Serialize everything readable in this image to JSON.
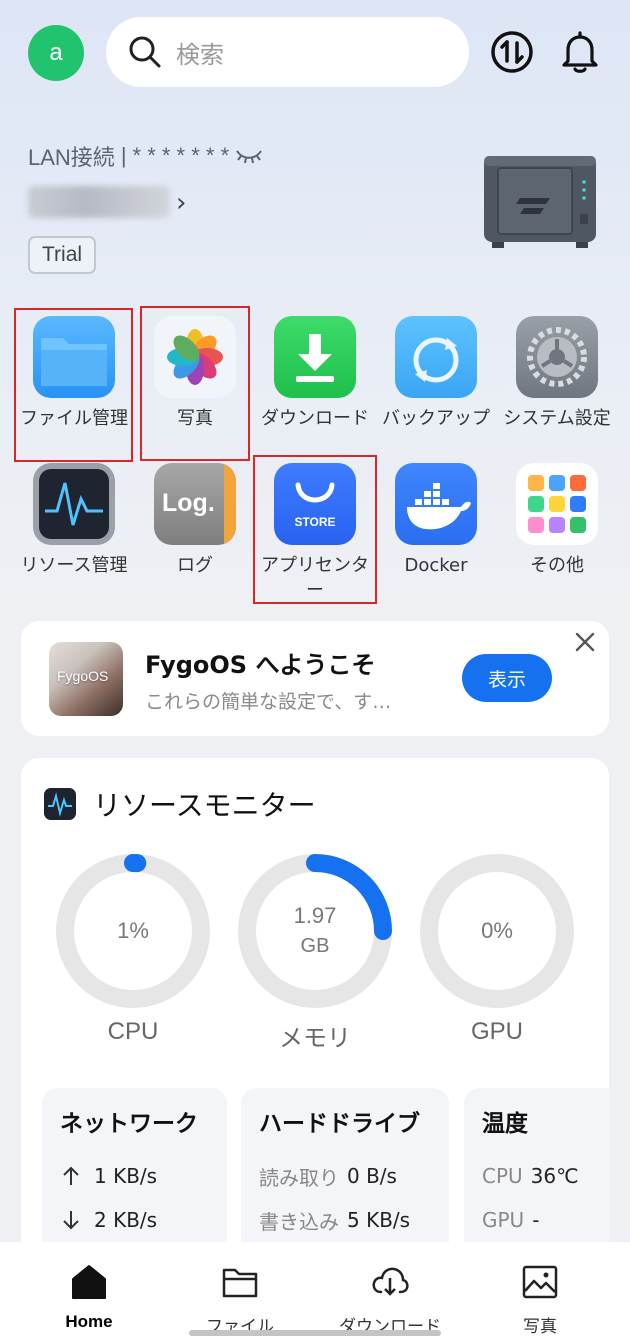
{
  "header": {
    "avatar_letter": "a",
    "search_placeholder": "検索"
  },
  "device": {
    "connection_type": "LAN接続",
    "separator": "|",
    "masked_address": "* * * * * * *",
    "trial_badge": "Trial"
  },
  "apps": [
    {
      "label": "ファイル管理",
      "icon": "folder-icon",
      "highlighted": true
    },
    {
      "label": "写真",
      "icon": "photos-icon",
      "highlighted": true
    },
    {
      "label": "ダウンロード",
      "icon": "download-icon",
      "highlighted": false
    },
    {
      "label": "バックアップ",
      "icon": "backup-icon",
      "highlighted": false
    },
    {
      "label": "システム設定",
      "icon": "gear-icon",
      "highlighted": false
    },
    {
      "label": "リソース管理",
      "icon": "activity-monitor-icon",
      "highlighted": false
    },
    {
      "label": "ログ",
      "icon": "log-icon",
      "icon_text": "Log.",
      "highlighted": false
    },
    {
      "label": "アプリセンター",
      "icon": "store-icon",
      "icon_text": "STORE",
      "highlighted": true
    },
    {
      "label": "Docker",
      "icon": "docker-icon",
      "highlighted": false
    },
    {
      "label": "その他",
      "icon": "more-apps-icon",
      "highlighted": false
    }
  ],
  "welcome": {
    "thumb_text": "FygoOS",
    "title": "FygoOS へようこそ",
    "subtitle": "これらの簡単な設定で、す…",
    "button": "表示"
  },
  "monitor": {
    "title": "リソースモニター",
    "gauges": [
      {
        "label": "CPU",
        "value": "1%",
        "unit": "",
        "fraction": 0.01
      },
      {
        "label": "メモリ",
        "value": "1.97",
        "unit": "GB",
        "fraction": 0.25
      },
      {
        "label": "GPU",
        "value": "0%",
        "unit": "",
        "fraction": 0
      }
    ],
    "network": {
      "title": "ネットワーク",
      "up": "1 KB/s",
      "down": "2 KB/s"
    },
    "disk": {
      "title": "ハードドライブ",
      "read_label": "読み取り",
      "read": "0 B/s",
      "write_label": "書き込み",
      "write": "5 KB/s"
    },
    "temperature": {
      "title": "温度",
      "cpu_label": "CPU",
      "cpu": "36℃",
      "gpu_label": "GPU",
      "gpu": "-"
    }
  },
  "nav": [
    {
      "label": "Home",
      "active": true
    },
    {
      "label": "ファイル",
      "active": false
    },
    {
      "label": "ダウンロード",
      "active": false
    },
    {
      "label": "写真",
      "active": false
    }
  ],
  "colors": {
    "accent": "#1671f0",
    "avatar": "#22c36f",
    "highlight_box": "#d9262b",
    "gauge_track": "#e6e6e6"
  }
}
